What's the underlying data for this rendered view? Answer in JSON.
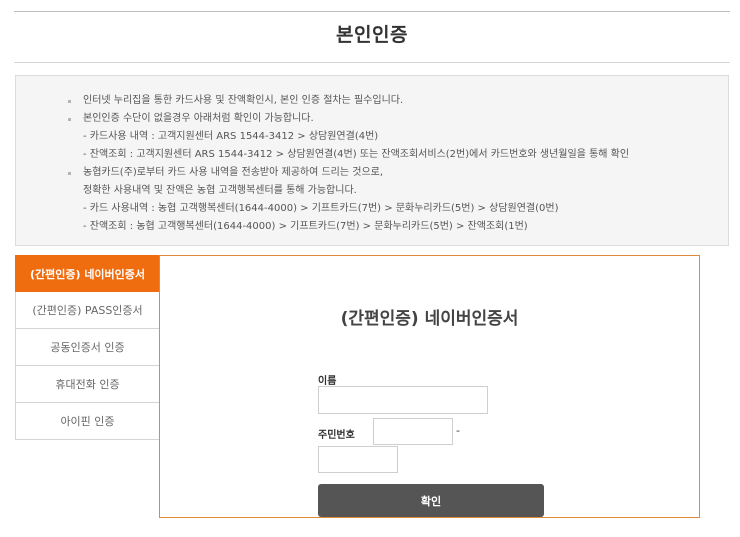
{
  "page": {
    "title": "본인인증"
  },
  "notice": {
    "lines": [
      {
        "kind": "bullet",
        "text": "인터넷 누리집을 통한 카드사용 및 잔액확인시, 본인 인증 절차는 필수입니다."
      },
      {
        "kind": "bullet",
        "text": "본인인증 수단이 없을경우 아래처럼 확인이 가능합니다."
      },
      {
        "kind": "sub",
        "text": "- 카드사용 내역 : 고객지원센터 ARS 1544-3412 > 상담원연결(4번)"
      },
      {
        "kind": "sub",
        "text": "- 잔액조회 : 고객지원센터 ARS 1544-3412 > 상담원연결(4번) 또는 잔액조회서비스(2번)에서 카드번호와 생년월일을 통해 확인"
      },
      {
        "kind": "bullet",
        "text": "농협카드(주)로부터 카드 사용 내역을 전송받아 제공하여 드리는 것으로,"
      },
      {
        "kind": "sub",
        "text": "정확한 사용내역 및 잔액은 농협 고객행복센터를 통해 가능합니다."
      },
      {
        "kind": "sub",
        "text": "- 카드 사용내역 : 농협 고객행복센터(1644-4000) > 기프트카드(7번) > 문화누리카드(5번) > 상담원연결(0번)"
      },
      {
        "kind": "sub",
        "text": "- 잔액조회 : 농협 고객행복센터(1644-4000) > 기프트카드(7번) > 문화누리카드(5번) > 잔액조회(1번)"
      }
    ]
  },
  "tabs": [
    {
      "label": "(간편인증) 네이버인증서",
      "active": true
    },
    {
      "label": "(간편인증) PASS인증서",
      "active": false
    },
    {
      "label": "공동인증서 인증",
      "active": false
    },
    {
      "label": "휴대전화 인증",
      "active": false
    },
    {
      "label": "아이핀 인증",
      "active": false
    }
  ],
  "form": {
    "title": "(간편인증) 네이버인증서",
    "name_label": "이름",
    "name_value": "",
    "rrn_label": "주민번호",
    "rrn_front_value": "",
    "rrn_dash": "-",
    "rrn_back_value": "",
    "confirm_label": "확인"
  },
  "colors": {
    "accent": "#ef6c0f",
    "button": "#555555",
    "panel_border": "#e08a3c"
  }
}
